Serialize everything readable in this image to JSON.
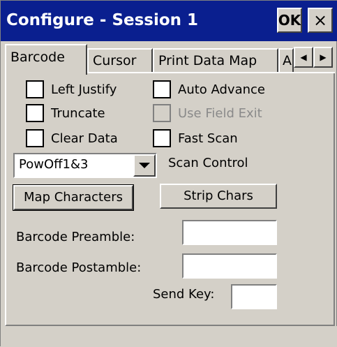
{
  "window": {
    "title": "Configure - Session 1",
    "ok_label": "OK",
    "close_label": "×"
  },
  "tabs": [
    {
      "label": "Barcode",
      "active": true
    },
    {
      "label": "Cursor",
      "active": false
    },
    {
      "label": "Print Data Map",
      "active": false
    },
    {
      "label": "A",
      "active": false
    }
  ],
  "tab_scroll": {
    "left_icon": "◀",
    "right_icon": "▶"
  },
  "checkboxes": [
    {
      "label": "Left Justify",
      "checked": false,
      "enabled": true
    },
    {
      "label": "Auto Advance",
      "checked": false,
      "enabled": true
    },
    {
      "label": "Truncate",
      "checked": false,
      "enabled": true
    },
    {
      "label": "Use Field Exit",
      "checked": false,
      "enabled": false
    },
    {
      "label": "Clear Data",
      "checked": false,
      "enabled": true
    },
    {
      "label": "Fast Scan",
      "checked": false,
      "enabled": true
    }
  ],
  "scan_control": {
    "selected": "PowOff1&3",
    "label": "Scan Control"
  },
  "buttons": {
    "map_characters": "Map Characters",
    "strip_chars": "Strip Chars"
  },
  "fields": {
    "preamble_label": "Barcode Preamble:",
    "preamble_value": "",
    "postamble_label": "Barcode Postamble:",
    "postamble_value": "",
    "send_key_label": "Send Key:",
    "send_key_value": ""
  }
}
